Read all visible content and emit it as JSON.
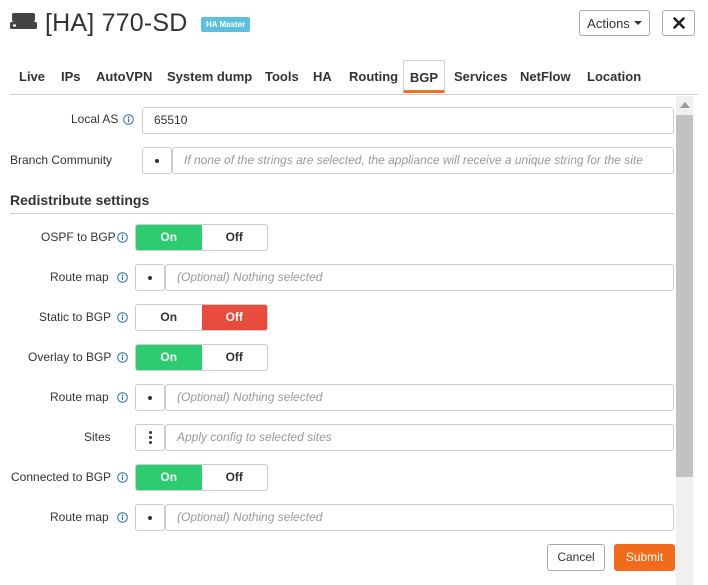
{
  "header": {
    "title": "[HA] 770-SD",
    "badge": "HA Master",
    "actions_label": "Actions",
    "close_icon": "close-icon"
  },
  "tabs": [
    "Live",
    "IPs",
    "AutoVPN",
    "System dump",
    "Tools",
    "HA",
    "Routing",
    "BGP",
    "Services",
    "NetFlow",
    "Location"
  ],
  "active_tab": "BGP",
  "form": {
    "local_as": {
      "label": "Local AS",
      "value": "65510"
    },
    "branch_community": {
      "label": "Branch Community",
      "placeholder": "If none of the strings are selected, the appliance will receive a unique string for the site"
    },
    "section_title": "Redistribute settings",
    "ospf": {
      "label": "OSPF to BGP",
      "on": "On",
      "off": "Off",
      "state": "on"
    },
    "ospf_route_map": {
      "label": "Route map",
      "placeholder": "(Optional) Nothing selected"
    },
    "static": {
      "label": "Static to BGP",
      "on": "On",
      "off": "Off",
      "state": "off"
    },
    "overlay": {
      "label": "Overlay to BGP",
      "on": "On",
      "off": "Off",
      "state": "on"
    },
    "overlay_route_map": {
      "label": "Route map",
      "placeholder": "(Optional) Nothing selected"
    },
    "sites": {
      "label": "Sites",
      "placeholder": "Apply config to selected sites"
    },
    "connected": {
      "label": "Connected to BGP",
      "on": "On",
      "off": "Off",
      "state": "on"
    },
    "connected_route_map": {
      "label": "Route map",
      "placeholder": "(Optional) Nothing selected"
    }
  },
  "footer": {
    "cancel": "Cancel",
    "submit": "Submit"
  },
  "colors": {
    "toggle_on": "#2ecc71",
    "toggle_off": "#e74c3c",
    "submit": "#f26a1b",
    "badge": "#5bc0de",
    "active_tab_underline": "#f37021"
  }
}
